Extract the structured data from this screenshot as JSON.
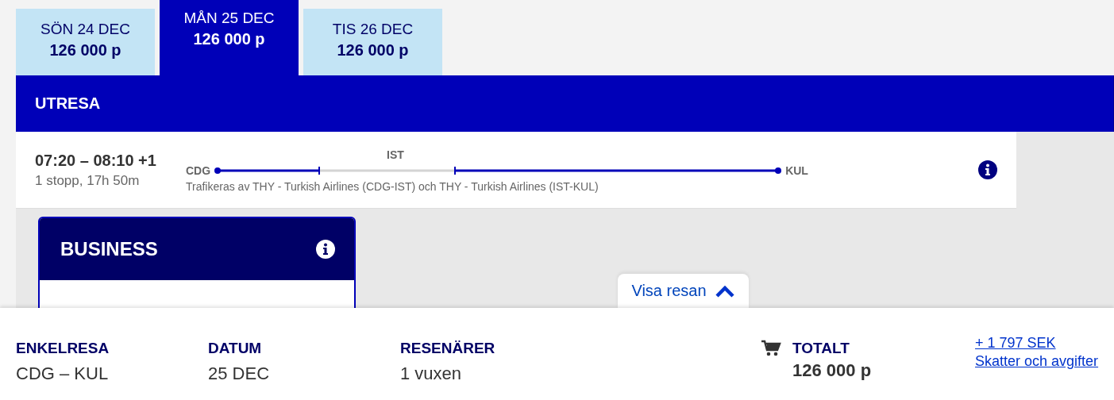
{
  "date_tabs": [
    {
      "day": "SÖN 24 DEC",
      "price": "126 000 p",
      "selected": false
    },
    {
      "day": "MÅN 25 DEC",
      "price": "126 000 p",
      "selected": true
    },
    {
      "day": "TIS 26 DEC",
      "price": "126 000 p",
      "selected": false
    }
  ],
  "section_title": "UTRESA",
  "flight": {
    "times": "07:20 – 08:10 +1",
    "stops": "1 stopp, 17h 50m",
    "origin": "CDG",
    "stopover": "IST",
    "destination": "KUL",
    "operator": "Trafikeras av THY - Turkish Airlines (CDG-IST) och THY - Turkish Airlines (IST-KUL)"
  },
  "fare_card": {
    "title": "BUSINESS"
  },
  "toggle": {
    "label": "Visa resan"
  },
  "summary": [
    {
      "label": "ENKELRESA",
      "value": "CDG – KUL"
    },
    {
      "label": "DATUM",
      "value": "25 DEC"
    },
    {
      "label": "RESENÄRER",
      "value": "1 vuxen"
    }
  ],
  "total": {
    "label": "TOTALT",
    "price": "126 000 p",
    "fee": "+ 1 797 SEK",
    "fee_note": "Skatter och avgifter"
  }
}
